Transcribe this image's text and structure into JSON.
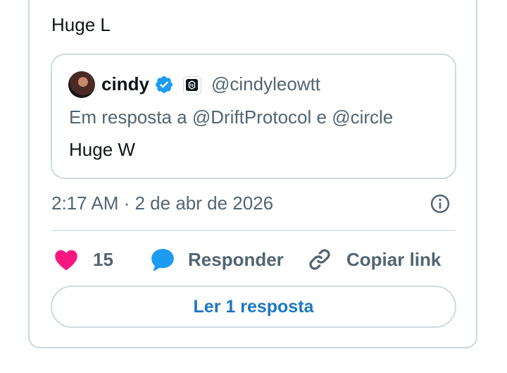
{
  "tweet": {
    "text": "Huge L"
  },
  "quote": {
    "author_name": "cindy",
    "author_handle": "@cindyleowtt",
    "reply_to": "Em resposta a @DriftProtocol e @circle",
    "text": "Huge W"
  },
  "meta": {
    "timestamp": "2:17 AM · 2 de abr de 2026"
  },
  "actions": {
    "like_count": "15",
    "reply_label": "Responder",
    "copy_label": "Copiar link"
  },
  "read_replies": {
    "label": "Ler 1 resposta"
  },
  "colors": {
    "like": "#f91880",
    "reply": "#1d9bf0",
    "verified": "#1d9bf0",
    "link": "#1d77c2",
    "secondary_text": "#536471"
  }
}
